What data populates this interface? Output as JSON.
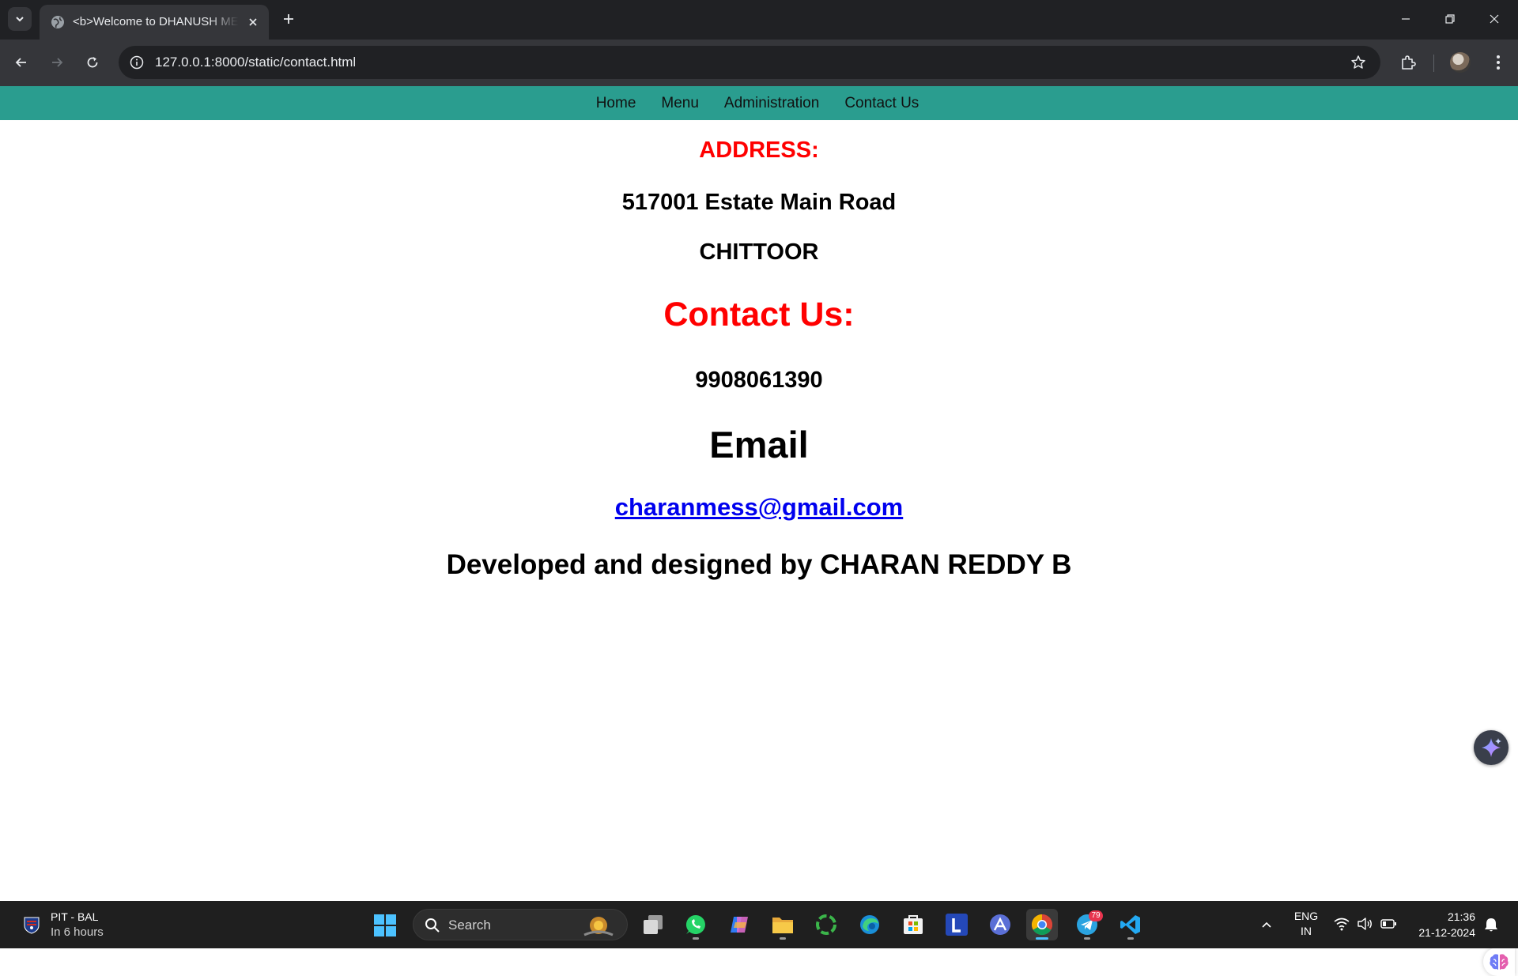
{
  "browser": {
    "tab_title": "<b>Welcome to DHANUSH MESS",
    "url": "127.0.0.1:8000/static/contact.html"
  },
  "site": {
    "nav": [
      {
        "label": "Home"
      },
      {
        "label": "Menu"
      },
      {
        "label": "Administration"
      },
      {
        "label": "Contact Us"
      }
    ],
    "address_heading": "ADDRESS:",
    "address_line1": "517001 Estate Main Road",
    "address_line2": "CHITTOOR",
    "contact_heading": "Contact Us:",
    "phone": "9908061390",
    "email_heading": "Email",
    "email": "charanmess@gmail.com",
    "credit": "Developed and designed by CHARAN REDDY B"
  },
  "taskbar": {
    "weather_title": "PIT - BAL",
    "weather_sub": "In 6 hours",
    "search_label": "Search",
    "telegram_badge": "79",
    "lang_line1": "ENG",
    "lang_line2": "IN",
    "time": "21:36",
    "date": "21-12-2024"
  },
  "colors": {
    "nav_bar": "#2a9d8f",
    "heading_red": "#ff0000",
    "link_blue": "#0000ee"
  }
}
